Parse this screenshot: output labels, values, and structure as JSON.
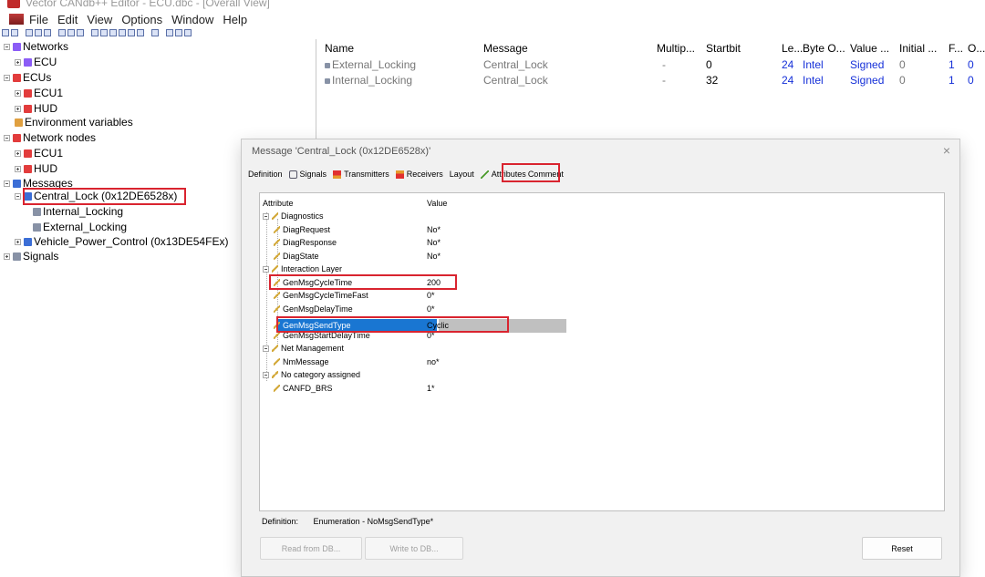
{
  "window": {
    "title": "Vector CANdb++ Editor - ECU.dbc - [Overall View]"
  },
  "menu": [
    "File",
    "Edit",
    "View",
    "Options",
    "Window",
    "Help"
  ],
  "colors": {
    "highlight_box": "#d9242f",
    "selection": "#1976d2",
    "link_blue": "#1530d8"
  },
  "tree": {
    "networks": "Networks",
    "ecu_net": "ECU",
    "ecus": "ECUs",
    "ecu1": "ECU1",
    "hud": "HUD",
    "env_vars": "Environment variables",
    "network_nodes": "Network nodes",
    "nn_ecu1": "ECU1",
    "nn_hud": "HUD",
    "messages": "Messages",
    "central_lock": "Central_Lock (0x12DE6528x)",
    "internal_locking": "Internal_Locking",
    "external_locking": "External_Locking",
    "vehicle_power": "Vehicle_Power_Control (0x13DE54FEx)",
    "signals": "Signals"
  },
  "grid": {
    "headers": [
      "Name",
      "Message",
      "Multip...",
      "Startbit",
      "Le...",
      "Byte O...",
      "Value ...",
      "Initial ...",
      "F...",
      "O..."
    ],
    "rows": [
      [
        "External_Locking",
        "Central_Lock",
        "-",
        "0",
        "24",
        "Intel",
        "Signed",
        "0",
        "1",
        "0"
      ],
      [
        "Internal_Locking",
        "Central_Lock",
        "-",
        "32",
        "24",
        "Intel",
        "Signed",
        "0",
        "1",
        "0"
      ]
    ]
  },
  "dialog": {
    "title": "Message 'Central_Lock (0x12DE6528x)'",
    "close": "×",
    "tabs": [
      "Definition",
      "Signals",
      "Transmitters",
      "Receivers",
      "Layout",
      "Attributes",
      "Comment"
    ],
    "col_attribute": "Attribute",
    "col_value": "Value",
    "rows": [
      {
        "name": "Diagnostics",
        "value": ""
      },
      {
        "name": "DiagRequest",
        "value": "No*"
      },
      {
        "name": "DiagResponse",
        "value": "No*"
      },
      {
        "name": "DiagState",
        "value": "No*"
      },
      {
        "name": "Interaction Layer",
        "value": ""
      },
      {
        "name": "GenMsgCycleTime",
        "value": "200"
      },
      {
        "name": "GenMsgCycleTimeFast",
        "value": "0*"
      },
      {
        "name": "GenMsgDelayTime",
        "value": "0*"
      },
      {
        "name": "GenMsgSendType",
        "value": "Cyclic"
      },
      {
        "name": "GenMsgStartDelayTime",
        "value": "0*"
      },
      {
        "name": "Net Management",
        "value": ""
      },
      {
        "name": "NmMessage",
        "value": "no*"
      },
      {
        "name": "No category assigned",
        "value": ""
      },
      {
        "name": "CANFD_BRS",
        "value": "1*"
      }
    ],
    "definition_label": "Definition:",
    "definition_value": "Enumeration - NoMsgSendType*",
    "read_btn": "Read from DB...",
    "write_btn": "Write to DB...",
    "reset_btn": "Reset"
  }
}
